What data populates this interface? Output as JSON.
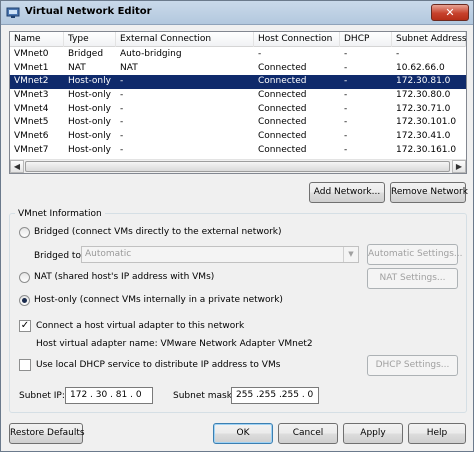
{
  "window": {
    "title": "Virtual Network Editor",
    "close_glyph": "✕"
  },
  "list": {
    "columns": [
      "Name",
      "Type",
      "External Connection",
      "Host Connection",
      "DHCP",
      "Subnet Address"
    ],
    "rows": [
      [
        "VMnet0",
        "Bridged",
        "Auto-bridging",
        "-",
        "-",
        "-"
      ],
      [
        "VMnet1",
        "NAT",
        "NAT",
        "Connected",
        "-",
        "10.62.66.0"
      ],
      [
        "VMnet2",
        "Host-only",
        "-",
        "Connected",
        "-",
        "172.30.81.0"
      ],
      [
        "VMnet3",
        "Host-only",
        "-",
        "Connected",
        "-",
        "172.30.80.0"
      ],
      [
        "VMnet4",
        "Host-only",
        "-",
        "Connected",
        "-",
        "172.30.71.0"
      ],
      [
        "VMnet5",
        "Host-only",
        "-",
        "Connected",
        "-",
        "172.30.101.0"
      ],
      [
        "VMnet6",
        "Host-only",
        "-",
        "Connected",
        "-",
        "172.30.41.0"
      ],
      [
        "VMnet7",
        "Host-only",
        "-",
        "Connected",
        "-",
        "172.30.161.0"
      ]
    ],
    "selected_row": "VMnet2",
    "scroll_left_glyph": "◀",
    "scroll_right_glyph": "▶"
  },
  "list_buttons": {
    "add_network": "Add Network...",
    "remove_network": "Remove Network"
  },
  "vmnet_info": {
    "group_label": "VMnet Information",
    "bridged_label": "Bridged (connect VMs directly to the external network)",
    "bridged_to_label": "Bridged to:",
    "bridged_to_value": "Automatic",
    "automatic_settings": "Automatic Settings...",
    "nat_label": "NAT (shared host's IP address with VMs)",
    "nat_settings": "NAT Settings...",
    "host_only_label": "Host-only (connect VMs internally in a private network)",
    "selected_mode": "host-only",
    "connect_adapter_label": "Connect a host virtual adapter to this network",
    "connect_adapter_checked": true,
    "adapter_name_label": "Host virtual adapter name: VMware Network Adapter VMnet2",
    "dhcp_label": "Use local DHCP service to distribute IP address to VMs",
    "dhcp_checked": false,
    "dhcp_settings": "DHCP Settings...",
    "subnet_ip_label": "Subnet IP:",
    "subnet_ip_value": "172 . 30 . 81 . 0",
    "subnet_mask_label": "Subnet mask:",
    "subnet_mask_value": "255 .255 .255 . 0",
    "check_glyph": "✓",
    "combo_arrow_glyph": "▼"
  },
  "footer": {
    "restore_defaults": "Restore Defaults",
    "ok": "OK",
    "cancel": "Cancel",
    "apply": "Apply",
    "help": "Help"
  },
  "colors": {
    "selection": "#0f2a6b",
    "titlebar": "#b9cde2",
    "close": "#c7422d"
  }
}
